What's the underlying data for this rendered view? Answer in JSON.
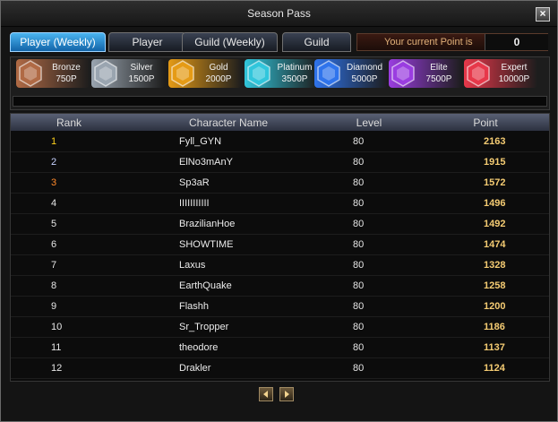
{
  "window": {
    "title": "Season Pass"
  },
  "tabs": [
    {
      "label": "Player (Weekly)"
    },
    {
      "label": "Player"
    },
    {
      "label": "Guild (Weekly)"
    },
    {
      "label": "Guild"
    }
  ],
  "point": {
    "label": "Your current Point is",
    "value": "0"
  },
  "tiers": [
    {
      "name": "Bronze",
      "points": "750P",
      "color": "#b06a45"
    },
    {
      "name": "Silver",
      "points": "1500P",
      "color": "#9aa5b0"
    },
    {
      "name": "Gold",
      "points": "2000P",
      "color": "#e59b16"
    },
    {
      "name": "Platinum",
      "points": "3500P",
      "color": "#31c6dc"
    },
    {
      "name": "Diamond",
      "points": "5000P",
      "color": "#2f74ec"
    },
    {
      "name": "Elite",
      "points": "7500P",
      "color": "#9a3de0"
    },
    {
      "name": "Expert",
      "points": "10000P",
      "color": "#e7384a"
    }
  ],
  "table": {
    "headers": {
      "rank": "Rank",
      "name": "Character Name",
      "level": "Level",
      "point": "Point"
    },
    "rows": [
      {
        "rank": "1",
        "name": "Fyll_GYN",
        "level": "80",
        "point": "2163"
      },
      {
        "rank": "2",
        "name": "ElNo3mAnY",
        "level": "80",
        "point": "1915"
      },
      {
        "rank": "3",
        "name": "Sp3aR",
        "level": "80",
        "point": "1572"
      },
      {
        "rank": "4",
        "name": "IIIIIIIIIII",
        "level": "80",
        "point": "1496"
      },
      {
        "rank": "5",
        "name": "BrazilianHoe",
        "level": "80",
        "point": "1492"
      },
      {
        "rank": "6",
        "name": "SHOWTIME",
        "level": "80",
        "point": "1474"
      },
      {
        "rank": "7",
        "name": "Laxus",
        "level": "80",
        "point": "1328"
      },
      {
        "rank": "8",
        "name": "EarthQuake",
        "level": "80",
        "point": "1258"
      },
      {
        "rank": "9",
        "name": "Flashh",
        "level": "80",
        "point": "1200"
      },
      {
        "rank": "10",
        "name": "Sr_Tropper",
        "level": "80",
        "point": "1186"
      },
      {
        "rank": "11",
        "name": "theodore",
        "level": "80",
        "point": "1137"
      },
      {
        "rank": "12",
        "name": "Drakler",
        "level": "80",
        "point": "1124"
      }
    ],
    "rank_colors": {
      "1": "#ffd21c",
      "2": "#c7d2ff",
      "3": "#ff8a2a",
      "other": "#e6e6e6"
    }
  },
  "pager": {
    "prev_icon": "arrow-left-icon",
    "next_icon": "arrow-right-icon"
  },
  "accent": "#2a8fe0"
}
